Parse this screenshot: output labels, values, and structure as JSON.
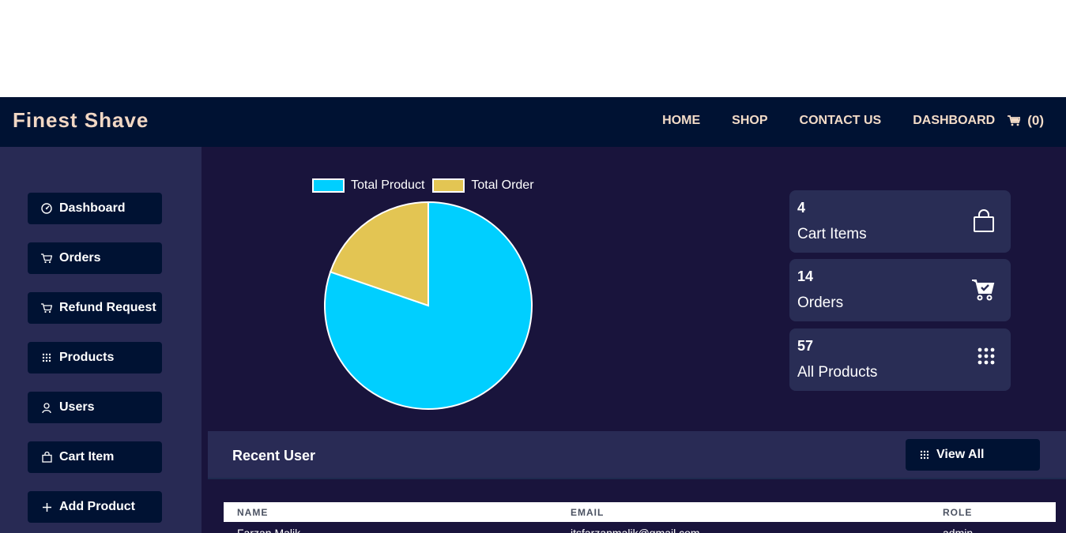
{
  "brand": "Finest Shave",
  "nav": {
    "home": "HOME",
    "shop": "SHOP",
    "contact": "CONTACT US",
    "dashboard": "DASHBOARD",
    "cart_count": "(0)",
    "cart_icon": "cart-icon"
  },
  "sidebar": {
    "items": [
      {
        "label": "Dashboard",
        "icon": "speedometer-icon"
      },
      {
        "label": "Orders",
        "icon": "cart-icon"
      },
      {
        "label": "Refund Request",
        "icon": "cart-icon"
      },
      {
        "label": "Products",
        "icon": "grid-icon"
      },
      {
        "label": "Users",
        "icon": "user-icon"
      },
      {
        "label": "Cart Item",
        "icon": "bag-icon"
      },
      {
        "label": "Add Product",
        "icon": "plus-icon"
      }
    ]
  },
  "chart_data": {
    "type": "pie",
    "categories": [
      "Total Product",
      "Total Order"
    ],
    "values": [
      57,
      14
    ],
    "colors": [
      "#00cfff",
      "#e3c553"
    ],
    "legend_position": "top"
  },
  "stats": [
    {
      "number": "4",
      "label": "Cart Items",
      "icon": "bag-icon"
    },
    {
      "number": "14",
      "label": "Orders",
      "icon": "cart-check-icon"
    },
    {
      "number": "57",
      "label": "All Products",
      "icon": "grid-icon"
    }
  ],
  "recent": {
    "title": "Recent User",
    "view_all": "View All",
    "columns": [
      "NAME",
      "EMAIL",
      "ROLE"
    ],
    "rows": [
      {
        "name": "Farzan Malik",
        "email": "itsfarzanmalik@gmail.com",
        "role": "admin"
      }
    ]
  },
  "colors": {
    "topbar": "#001233",
    "sidebar": "#282a54",
    "main": "#19143c",
    "card": "#292d55",
    "accent_text": "#f3dcc8"
  }
}
